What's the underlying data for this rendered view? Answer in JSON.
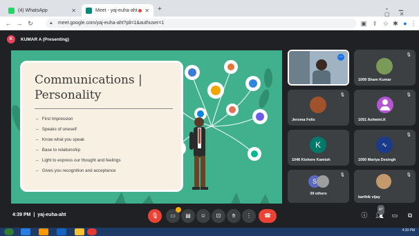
{
  "browser": {
    "tabs": [
      {
        "label": "(4) WhatsApp",
        "active": false
      },
      {
        "label": "Meet - yaj-euha-aht",
        "active": true
      }
    ],
    "new_tab": "+",
    "url": "meet.google.com/yaj-euha-aht?pli=1&authuser=1"
  },
  "meet": {
    "presenter": {
      "initial": "K",
      "label": "KUMAR A (Presenting)"
    },
    "slide": {
      "title_line1": "Communications |",
      "title_line2": "Personality",
      "bullets": [
        "First Impression",
        "Speaks of oneself",
        "Know what you speak",
        "Base to relationship",
        "Light to express our thought and feelings",
        "Gives you recognition and acceptance"
      ]
    },
    "participants": [
      {
        "name": "",
        "kind": "video"
      },
      {
        "name": "1009 Sham Kumar",
        "kind": "photo"
      },
      {
        "name": "Jeroma Felix",
        "kind": "photo"
      },
      {
        "name": "1051 Ashwini.K",
        "kind": "avatar",
        "initial": ""
      },
      {
        "name": "1046 Kishore Kamish",
        "kind": "letter",
        "initial": "K"
      },
      {
        "name": "1050 Mariya Desingh",
        "kind": "audio"
      },
      {
        "name": "39 others",
        "kind": "others",
        "initial": "S"
      },
      {
        "name": "karthik vijay",
        "kind": "photo"
      }
    ],
    "bottom": {
      "time": "4:39 PM",
      "separator": "|",
      "meeting_code": "yaj-euha-aht",
      "participant_count": "47"
    },
    "colors": {
      "bg": "#202124",
      "tile": "#3c4043",
      "slide_bg": "#41b08d",
      "card_bg": "#f7f0e3",
      "end_call": "#ea4335",
      "accent_purple": "#b455d2",
      "letter_avatar": "#00796b"
    }
  },
  "taskbar": {
    "time": "4:39 PM"
  },
  "icons": [
    "chrome-icon",
    "whatsapp-icon",
    "meet-icon",
    "mic-off-icon",
    "camera-icon",
    "captions-icon",
    "emoji-icon",
    "present-icon",
    "raise-hand-icon",
    "more-icon",
    "end-call-icon",
    "info-icon",
    "people-icon",
    "chat-icon",
    "activities-icon"
  ]
}
